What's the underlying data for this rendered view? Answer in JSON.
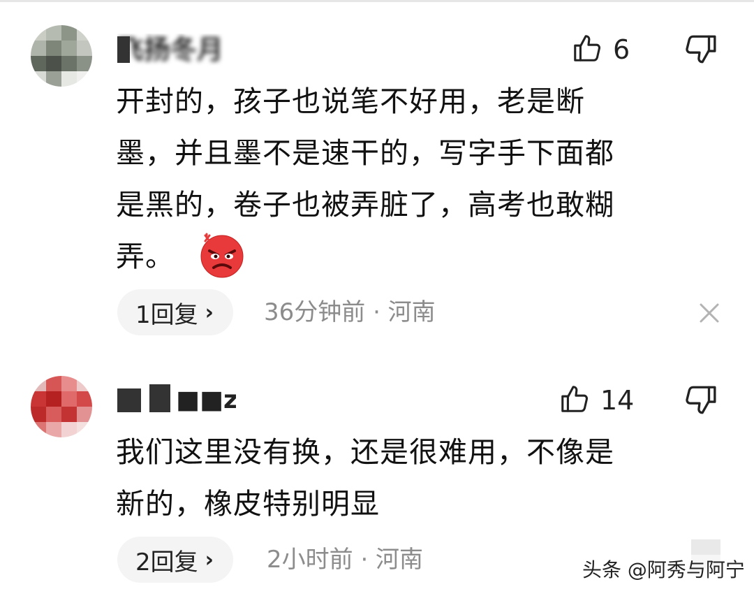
{
  "comments": [
    {
      "username": "飞扬冬月",
      "likes": "6",
      "text_lines": [
        "开封的，孩子也说笔不好用，老是断",
        "墨，并且墨不是速干的，写字手下面都",
        "是黑的，卷子也被弄脏了，高考也敢糊",
        "弄。"
      ],
      "emoji": "angry-face-emoji",
      "replies": "1回复",
      "reply_chevron": "›",
      "meta": "36分钟前 · 河南",
      "close": "×"
    },
    {
      "username": "■■zzz",
      "likes": "14",
      "text_lines": [
        "我们这里没有换，还是很难用，不像是",
        "新的，橡皮特别明显"
      ],
      "replies": "2回复",
      "reply_chevron": "›",
      "meta": "2小时前 · 河南"
    }
  ],
  "watermark": "头条 @阿秀与阿宁",
  "colors": {
    "text": "#111111",
    "meta": "#8c8c8c",
    "pill_bg": "#f4f4f4",
    "icon_stroke": "#222222",
    "emoji_red": "#e83a3a"
  }
}
